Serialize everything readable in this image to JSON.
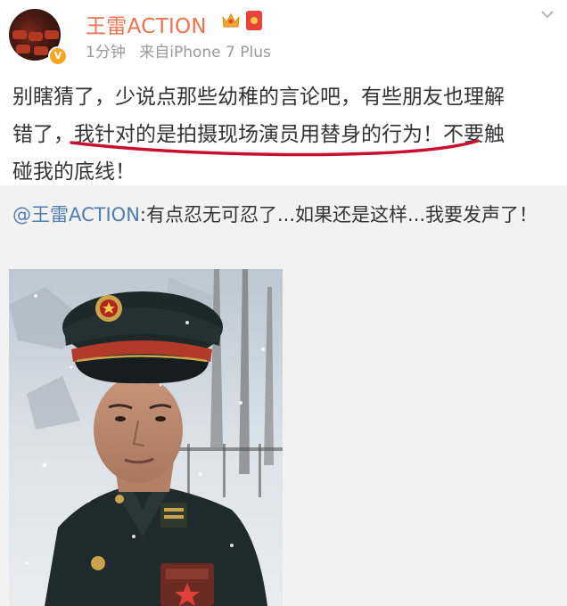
{
  "post": {
    "author": "王雷ACTION",
    "time": "1分钟",
    "source": "来自iPhone 7 Plus",
    "text_line1": "别瞎猜了，少说点那些幼稚的言论吧，有些朋友也理解",
    "text_line2": "错了，我针对的是拍摄现场演员用替身的行为！不要触",
    "text_line3": "碰我的底线！"
  },
  "repost": {
    "mention": "@王雷ACTION",
    "text": ":有点忍无可忍了...如果还是这样...我要发声了！"
  },
  "icons": [
    "crown-icon",
    "red-packet-icon",
    "chevron-down-icon",
    "verified-badge-icon"
  ],
  "colors": {
    "username": "#eb7350",
    "mention": "#507daf",
    "underline": "#c8102e",
    "repost_bg": "#f2f2f2"
  }
}
